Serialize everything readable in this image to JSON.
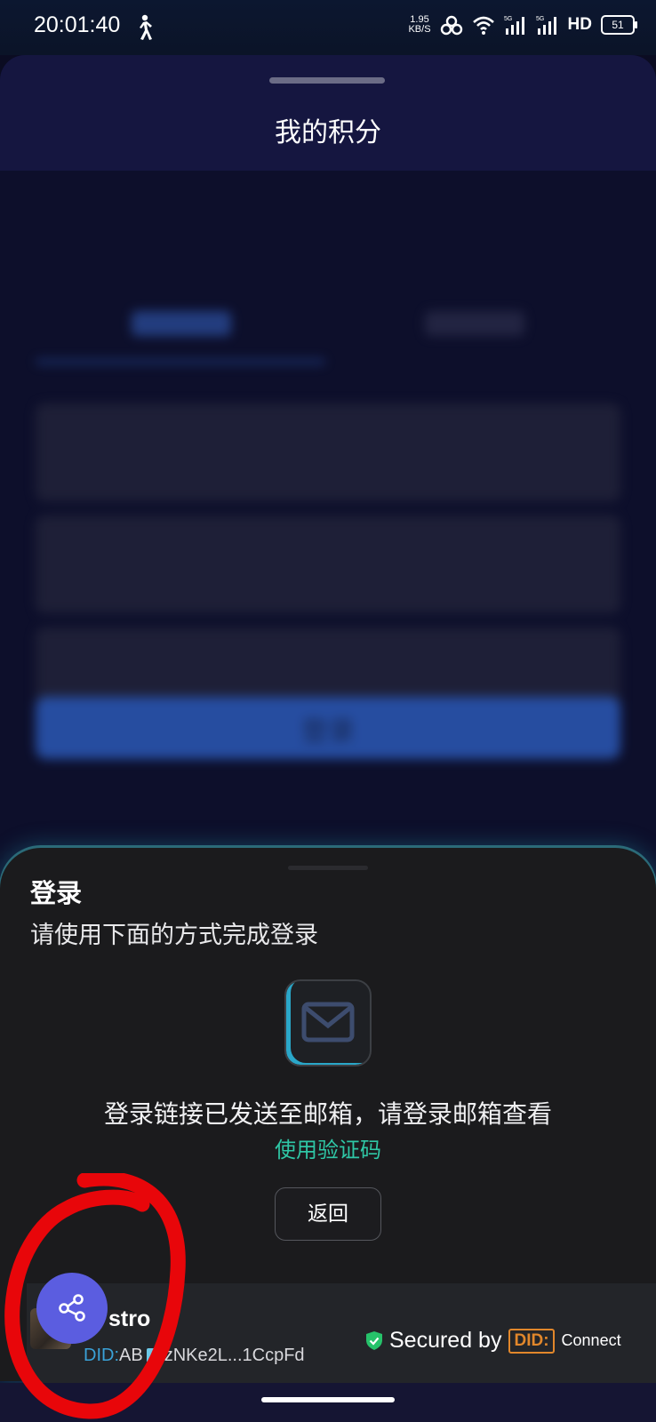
{
  "status_bar": {
    "time": "20:01:40",
    "net_speed_value": "1.95",
    "net_speed_unit": "KB/S",
    "network_label": "HD",
    "battery": "51",
    "icons": [
      "walk-icon",
      "hotspot-icon",
      "wifi-icon",
      "signal-5g-icon",
      "signal-5g-icon"
    ]
  },
  "sheet": {
    "title": "我的积分"
  },
  "background_page": {
    "submit_label": "登录"
  },
  "login": {
    "title": "登录",
    "subtitle": "请使用下面的方式完成登录",
    "icon": "mail-icon",
    "sent_message": "登录链接已发送至邮箱，请登录邮箱查看",
    "use_code_link": "使用验证码",
    "back_button": "返回"
  },
  "footer": {
    "app_name": "stro",
    "did_prefix": "DID:",
    "did_short": "AB",
    "did_value": "zNKe2L...1CcpFd",
    "secured_by": "Secured by",
    "did_logo": "DID:",
    "connect": "Connect"
  },
  "fab": {
    "icon": "share-icon"
  },
  "colors": {
    "accent_teal": "#2fc7a6",
    "fab_purple": "#5b5de0",
    "did_orange": "#e1872b",
    "annotation_red": "#e8060a"
  }
}
